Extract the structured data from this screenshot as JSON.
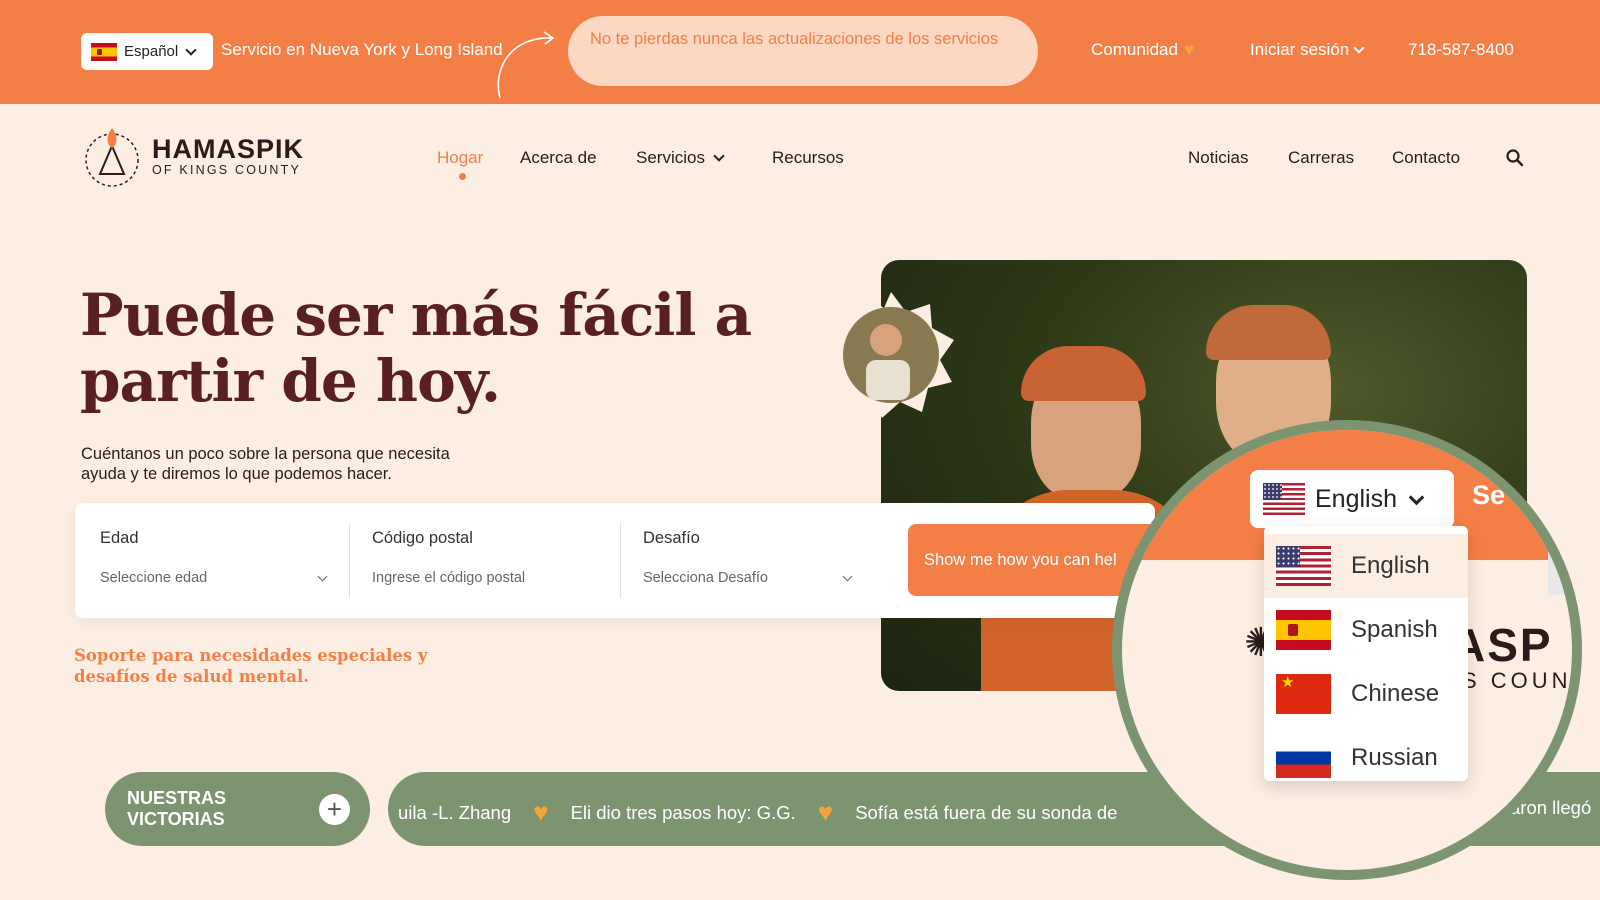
{
  "colors": {
    "brand_orange": "#f47f46",
    "brand_green": "#7d9470",
    "headline": "#5a1f23",
    "background": "#fdeee3"
  },
  "topbar": {
    "language_label": "Español",
    "service_area": "Servicio en Nueva York y Long Island",
    "notice": "No te pierdas nunca las actualizaciones de los servicios",
    "community": "Comunidad",
    "login": "Iniciar sesión",
    "phone": "718-587-8400"
  },
  "logo": {
    "title": "HAMASPIK",
    "subtitle": "OF KINGS COUNTY"
  },
  "nav": {
    "home": "Hogar",
    "about": "Acerca de",
    "services": "Servicios",
    "resources": "Recursos",
    "news": "Noticias",
    "careers": "Carreras",
    "contact": "Contacto"
  },
  "hero": {
    "title": "Puede ser más fácil a partir de hoy.",
    "subtitle": "Cuéntanos un poco sobre la persona que necesita ayuda y te diremos lo que podemos hacer.",
    "support": "Soporte para necesidades especiales y desafíos de salud mental."
  },
  "form": {
    "age_label": "Edad",
    "age_placeholder": "Seleccione edad",
    "zip_label": "Código postal",
    "zip_placeholder": "Ingrese el código postal",
    "challenge_label": "Desafío",
    "challenge_placeholder": "Selecciona Desafío",
    "submit": "Show me how you can hel"
  },
  "victories": {
    "label": "NUESTRAS VICTORIAS",
    "items": [
      "uila -L. Zhang",
      "Eli dio tres pasos hoy: G.G.",
      "Sofía está fuera de su sonda de"
    ],
    "tail": "aron llegó"
  },
  "magnifier": {
    "selected": "English",
    "cut_text": "Se",
    "brand_cut": "ASP",
    "brand_sub_cut": "S COUN",
    "options": [
      "English",
      "Spanish",
      "Chinese",
      "Russian"
    ]
  }
}
